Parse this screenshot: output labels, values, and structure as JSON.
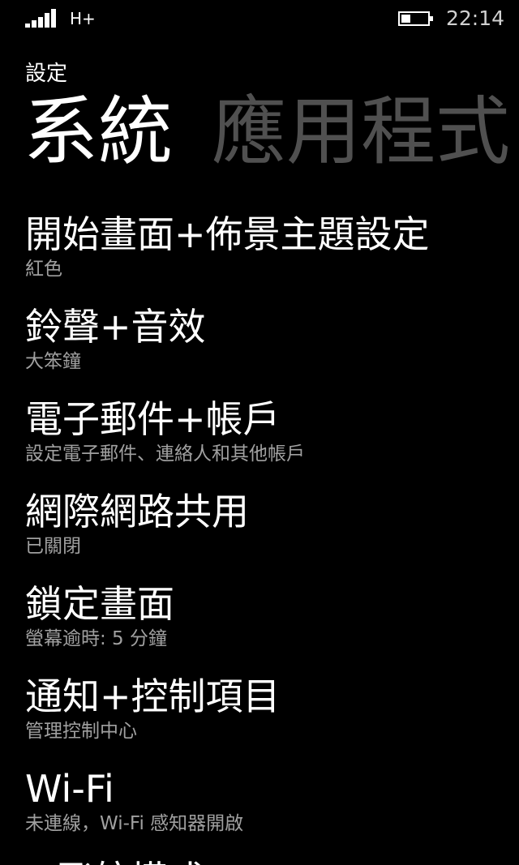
{
  "status_bar": {
    "network_type": "H+",
    "time": "22:14",
    "signal_icon": "signal-bars-icon",
    "battery_icon": "battery-icon",
    "battery_level": 0.35
  },
  "app_title": "設定",
  "pivot": {
    "tabs": [
      {
        "label": "系統",
        "active": true
      },
      {
        "label": "應用程式",
        "active": false
      }
    ]
  },
  "settings": {
    "items": [
      {
        "title": "開始畫面+佈景主題設定",
        "subtitle": "紅色"
      },
      {
        "title": "鈴聲+音效",
        "subtitle": "大笨鐘"
      },
      {
        "title": "電子郵件+帳戶",
        "subtitle": "設定電子郵件、連絡人和其他帳戶"
      },
      {
        "title": "網際網路共用",
        "subtitle": "已關閉"
      },
      {
        "title": "鎖定畫面",
        "subtitle": "螢幕逾時: 5 分鐘"
      },
      {
        "title": "通知+控制項目",
        "subtitle": "管理控制中心"
      },
      {
        "title": "Wi-Fi",
        "subtitle": "未連線，Wi-Fi 感知器開啟"
      }
    ]
  },
  "colors": {
    "background": "#000000",
    "text_primary": "#ffffff",
    "text_secondary": "#a0a0a0",
    "tab_inactive": "#505050"
  }
}
